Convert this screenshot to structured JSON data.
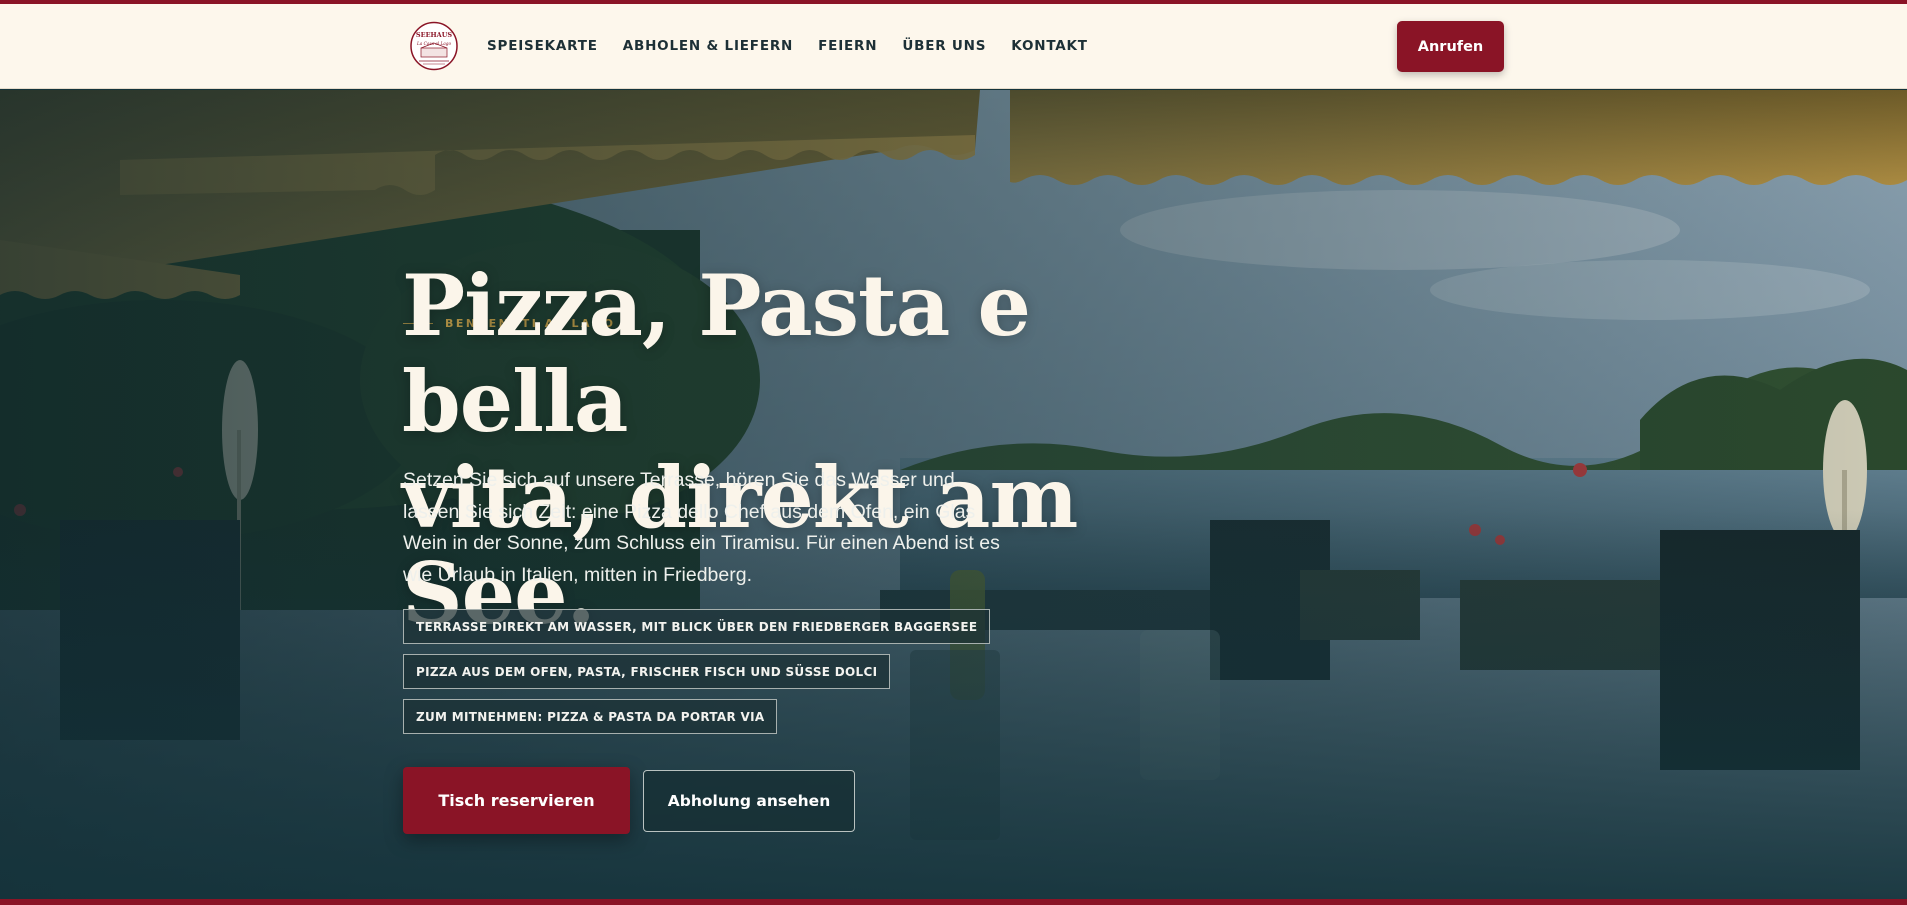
{
  "brand": {
    "logo_text_top": "SEEHAUS",
    "logo_text_script": "La Casa al Lago"
  },
  "nav": {
    "items": [
      "SPEISEKARTE",
      "ABHOLEN & LIEFERN",
      "FEIERN",
      "ÜBER UNS",
      "KONTAKT"
    ]
  },
  "header": {
    "call_label": "Anrufen"
  },
  "hero": {
    "eyebrow": "BENVENUTI AL LAGO",
    "headline_line1": "Pizza, Pasta e bella",
    "headline_line2": "vita, direkt am See.",
    "lead": "Setzen Sie sich auf unsere Terrasse, hören Sie das Wasser und lassen Sie sich Zeit: eine Pizza dello Chef aus dem Ofen, ein Glas Wein in der Sonne, zum Schluss ein Tiramisu. Für einen Abend ist es wie Urlaub in Italien, mitten in Friedberg.",
    "chips": [
      "TERRASSE DIREKT AM WASSER, MIT BLICK ÜBER DEN FRIEDBERGER BAGGERSEE",
      "PIZZA AUS DEM OFEN, PASTA, FRISCHER FISCH UND SÜSSE DOLCI",
      "ZUM MITNEHMEN: PIZZA & PASTA DA PORTAR VIA"
    ],
    "cta_primary": "Tisch reservieren",
    "cta_secondary": "Abholung ansehen"
  },
  "colors": {
    "brand_red": "#8a1426",
    "cream": "#fdf7ec",
    "accent_gold": "#d8a84a",
    "overlay_teal": "#14333a"
  }
}
